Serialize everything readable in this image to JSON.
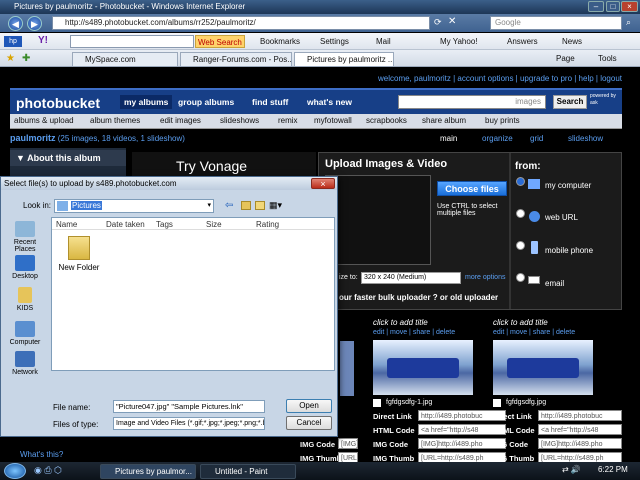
{
  "window": {
    "title": "Pictures by paulmoritz - Photobucket - Windows Internet Explorer"
  },
  "address": {
    "url": "http://s489.photobucket.com/albums/rr252/paulmoritz/",
    "search_placeholder": "Google"
  },
  "toolbar": {
    "web_search": "Web Search",
    "bookmarks": "Bookmarks",
    "settings": "Settings",
    "mail": "Mail",
    "my_yahoo": "My Yahoo!",
    "answers": "Answers",
    "news": "News",
    "page": "Page",
    "tools": "Tools"
  },
  "tabs": [
    {
      "label": "MySpace.com"
    },
    {
      "label": "Ranger-Forums.com - Pos..."
    },
    {
      "label": "Pictures by paulmoritz ..."
    }
  ],
  "photobucket": {
    "top_links": "welcome, paulmoritz | account options | upgrade to pro | help | logout",
    "logo": "photobucket",
    "nav": [
      "my albums",
      "group albums",
      "find stuff",
      "what's new"
    ],
    "search_placeholder": "images",
    "search_button": "Search",
    "powered_by": "powered by ask",
    "subnav": [
      "albums & upload",
      "album themes",
      "edit images",
      "slideshows",
      "remix",
      "myfotowall",
      "scrapbooks",
      "share album",
      "buy prints"
    ],
    "user": {
      "name": "paulmoritz",
      "stats": "(25 images, 18 videos, 1 slideshow)"
    },
    "view_options": [
      "main",
      "organize",
      "grid",
      "slideshow"
    ],
    "about_album": "About this album",
    "ad_text": "Try Vonage",
    "upload": {
      "title": "Upload Images & Video",
      "choose_button": "Choose files",
      "ctrl_hint": "Use CTRL to select multiple files",
      "resize_label": "ize to:",
      "resize_value": "320 x 240 (Medium)",
      "more_options": "more options",
      "faster": "our faster bulk uploader ? or old uploader",
      "from_label": "from:",
      "sources": [
        "my computer",
        "web URL",
        "mobile phone",
        "email"
      ]
    },
    "images": [
      {
        "add_title": "click to add title",
        "actions": "edit | move | share | delete",
        "filename": "fgfdgsdfg-1.jpg",
        "direct": "http://i489.photobuc",
        "html": "<a href=\"http://s48",
        "img": "[IMG]http://i489.pho",
        "thumb": "[URL=http://s489.ph"
      },
      {
        "add_title": "click to add title",
        "actions": "edit | move | share | delete",
        "filename": "fgfdgsdfg.jpg",
        "direct": "http://i489.photobuc",
        "html": "<a href=\"http://s48",
        "img": "[IMG]http://i489.pho",
        "thumb": "[URL=http://s489.ph"
      }
    ],
    "code_labels": [
      "Direct Link",
      "HTML Code",
      "IMG Code",
      "IMG Thumb"
    ],
    "left_partial": [
      "IMG Code",
      "IMG Thumb"
    ],
    "left_partial_values": [
      "[IMG]http:",
      "[URL=http:"
    ],
    "whats_this": "What's this?"
  },
  "dialog": {
    "title": "Select file(s) to upload by s489.photobucket.com",
    "look_in_label": "Look in:",
    "look_in_value": "Pictures",
    "places": [
      "Recent Places",
      "Desktop",
      "KIDS",
      "Computer",
      "Network"
    ],
    "columns": [
      "Name",
      "Date taken",
      "Tags",
      "Size",
      "Rating"
    ],
    "items": [
      {
        "label": "New Folder"
      }
    ],
    "file_name_label": "File name:",
    "file_name_value": "\"Picture047.jpg\" \"Sample Pictures.lnk\"",
    "file_type_label": "Files of type:",
    "file_type_value": "Image and Video Files (*.gif;*.jpg;*.jpeg;*.png;*.b",
    "open_button": "Open",
    "cancel_button": "Cancel"
  },
  "taskbar": {
    "tasks": [
      "Pictures by paulmor...",
      "Untitled - Paint"
    ],
    "time": "6:22 PM"
  }
}
